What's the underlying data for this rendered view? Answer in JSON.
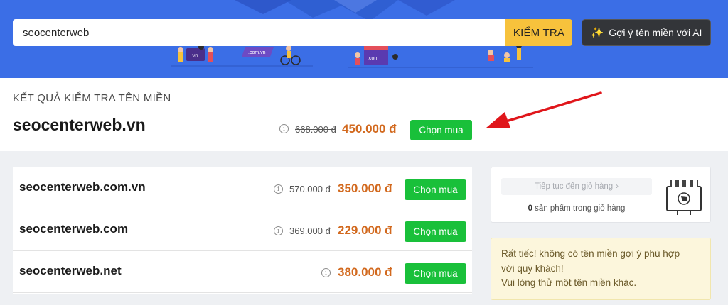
{
  "search": {
    "value": "seocenterweb",
    "check_label": "KIỂM TRA"
  },
  "ai_button": {
    "label": "Gợi ý tên miền với AI"
  },
  "hero_art": {
    "badge_vn": ".vn",
    "badge_comvn": ".com.vn",
    "badge_com": ".com"
  },
  "result": {
    "heading": "KẾT QUẢ KIỂM TRA TÊN MIỀN",
    "domain": "seocenterweb.vn",
    "info": "i",
    "old_price": "668.000 đ",
    "new_price": "450.000 đ",
    "buy_label": "Chọn mua"
  },
  "list": [
    {
      "domain": "seocenterweb.com.vn",
      "info": "i",
      "old_price": "570.000 đ",
      "new_price": "350.000 đ",
      "buy_label": "Chọn mua"
    },
    {
      "domain": "seocenterweb.com",
      "info": "i",
      "old_price": "369.000 đ",
      "new_price": "229.000 đ",
      "buy_label": "Chọn mua"
    },
    {
      "domain": "seocenterweb.net",
      "info": "i",
      "old_price": "",
      "new_price": "380.000 đ",
      "buy_label": "Chọn mua"
    }
  ],
  "cart": {
    "link_label": "Tiếp tục đến giỏ hàng",
    "chevron": "›",
    "count": "0",
    "count_suffix": " sản phẩm trong giỏ hàng"
  },
  "notice": {
    "lines": [
      "Rất tiếc! không có tên miền gợi ý phù hợp",
      "với quý khách!",
      "Vui lòng thử một tên miền khác."
    ]
  },
  "colors": {
    "hero_blue": "#3b6ee6",
    "check_yellow": "#f7c23c",
    "buy_green": "#19c03a",
    "price_orange": "#d2691e",
    "arrow_red": "#e0161b"
  },
  "icons": {
    "ai": "sparkle-icon",
    "info": "info-icon",
    "cart": "cart-icon",
    "arrow": "red-arrow-pointer"
  }
}
